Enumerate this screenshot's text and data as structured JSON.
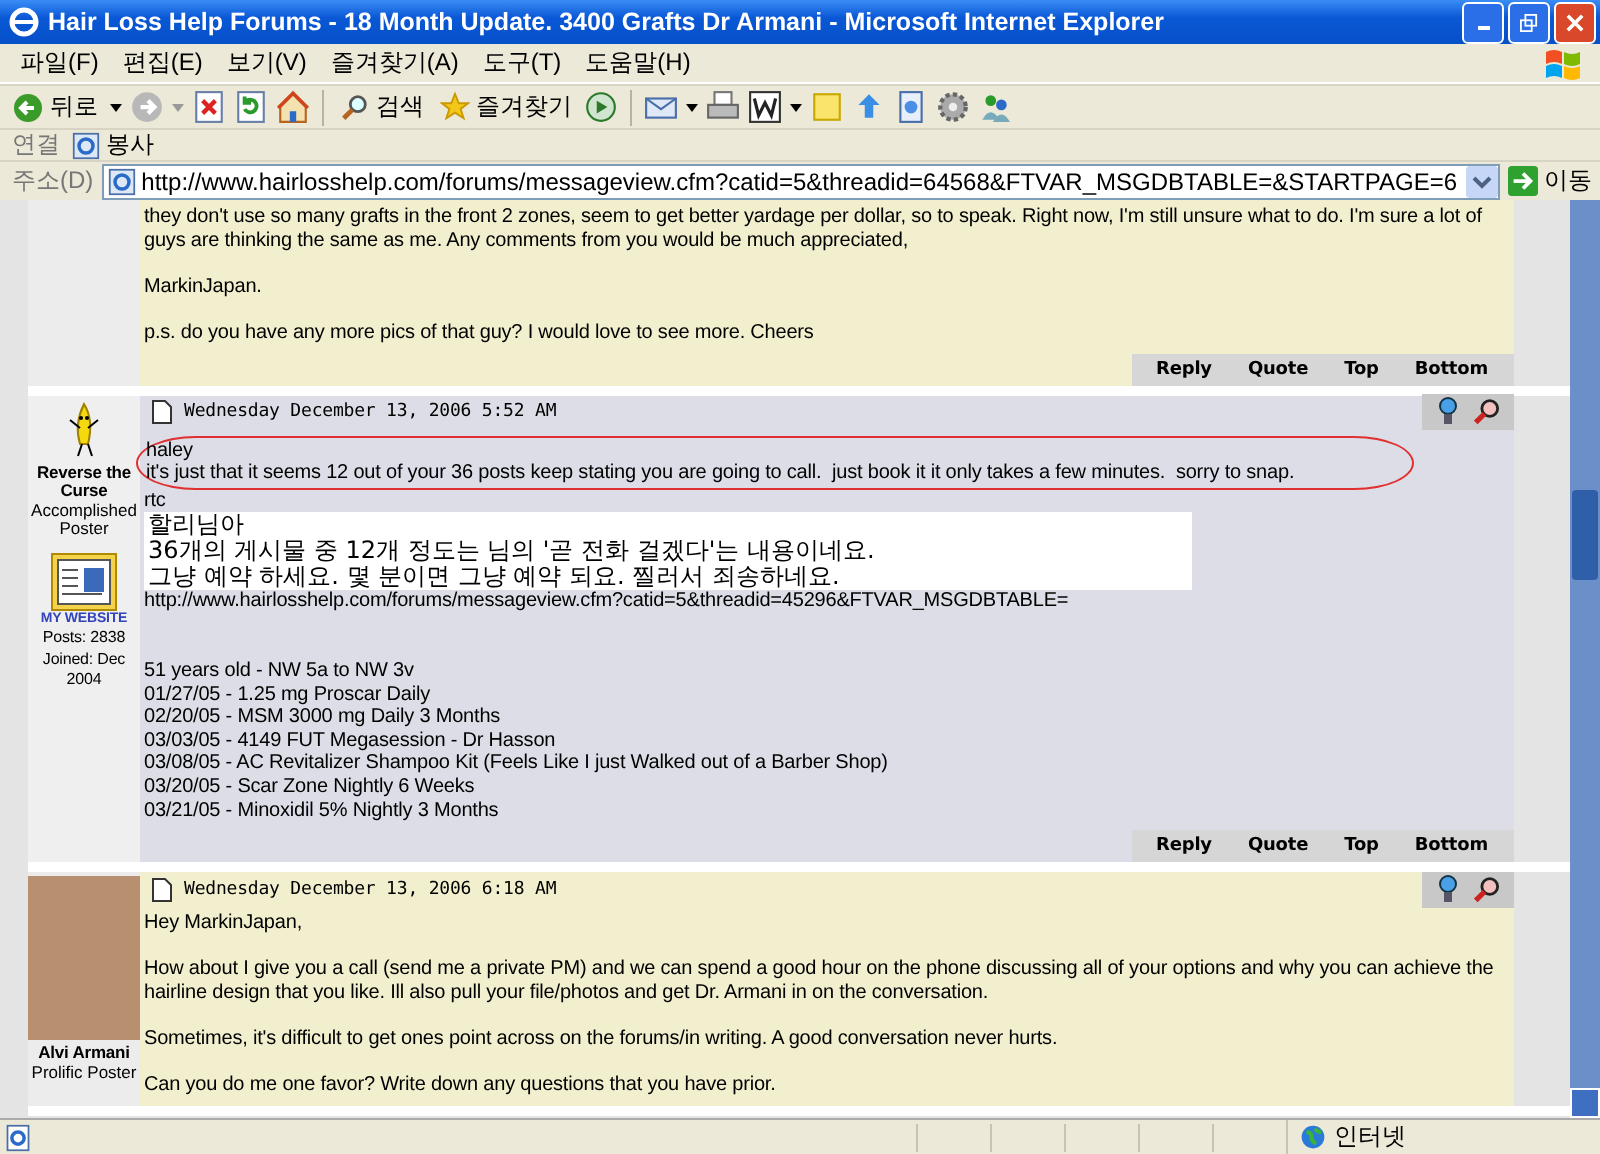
{
  "window": {
    "title": "Hair Loss Help Forums - 18 Month Update. 3400 Grafts Dr Armani - Microsoft Internet Explorer"
  },
  "menu": [
    "파일(F)",
    "편집(E)",
    "보기(V)",
    "즐겨찾기(A)",
    "도구(T)",
    "도움말(H)"
  ],
  "toolbar": {
    "back": "뒤로",
    "search": "검색",
    "favorites": "즐겨찾기"
  },
  "links_bar": {
    "label": "연결",
    "links": [
      "봉사"
    ]
  },
  "address_bar": {
    "label": "주소(D)",
    "url": "http://www.hairlosshelp.com/forums/messageview.cfm?catid=5&threadid=64568&FTVAR_MSGDBTABLE=&STARTPAGE=6",
    "go": "이동"
  },
  "posts": [
    {
      "kind": "beige",
      "body": [
        {
          "kind": "para",
          "lines": [
            "they don't use so many grafts in the front 2 zones, seem to get better yardage per dollar, so to speak. Right now, I'm still unsure what to do. I'm sure a lot of guys are thinking the same as me. Any comments from you would be much appreciated,"
          ]
        },
        {
          "kind": "para",
          "lines": [
            "MarkinJapan."
          ]
        },
        {
          "kind": "line",
          "lines": [
            "p.s. do you have any more pics of that guy? I would love to see more. Cheers"
          ]
        }
      ],
      "actions": [
        "Reply",
        "Quote",
        "Top",
        "Bottom"
      ]
    },
    {
      "kind": "grey",
      "avatar": {
        "kind": "banana"
      },
      "author": "Reverse the Curse",
      "rank": "Accomplished Poster",
      "website": "MY WEBSITE",
      "stats": [
        "Posts: 2838",
        "Joined: Dec 2004"
      ],
      "date": "Wednesday December 13, 2006 5:52 AM",
      "body": [
        {
          "kind": "circled",
          "lines": [
            "haley",
            "it's just that it seems 12 out of your 36 posts keep stating you are going to call.  just book it it only takes a few minutes.  sorry to snap."
          ]
        },
        {
          "kind": "line",
          "lines": [
            "rtc"
          ]
        },
        {
          "kind": "translation",
          "lines": [
            "할리님아",
            "36개의 게시물 중 12개 정도는 님의 '곧 전화 걸겠다'는 내용이네요.",
            "그냥 예약 하세요. 몇 분이면 그냥 예약 되요. 찔러서 죄송하네요."
          ]
        },
        {
          "kind": "section",
          "lines": [
            "http://www.hairlosshelp.com/forums/messageview.cfm?catid=5&threadid=45296&FTVAR_MSGDBTABLE="
          ]
        },
        {
          "kind": "line",
          "lines": [
            "51 years old - NW 5a to NW 3v",
            "01/27/05 - 1.25 mg Proscar Daily",
            "02/20/05 - MSM 3000 mg Daily 3 Months",
            "03/03/05 - 4149 FUT Megasession - Dr Hasson",
            "03/08/05 - AC Revitalizer Shampoo Kit (Feels Like I just Walked out of a Barber Shop)",
            "03/20/05 - Scar Zone Nightly 6 Weeks",
            "03/21/05 - Minoxidil 5% Nightly 3 Months"
          ]
        }
      ],
      "actions": [
        "Reply",
        "Quote",
        "Top",
        "Bottom"
      ]
    },
    {
      "kind": "beige",
      "avatar": {
        "kind": "photo"
      },
      "author": "Alvi Armani",
      "rank": "Prolific Poster",
      "date": "Wednesday December 13, 2006 6:18 AM",
      "body": [
        {
          "kind": "para",
          "lines": [
            "Hey MarkinJapan,"
          ]
        },
        {
          "kind": "para",
          "lines": [
            "How about I give you a call (send me a private PM) and we can spend a good hour on the phone discussing all of your options and why you can achieve the hairline design that you like. Ill also pull your file/photos and get Dr. Armani in on the conversation."
          ]
        },
        {
          "kind": "para",
          "lines": [
            "Sometimes, it's difficult to get ones point across on the forums/in writing. A good conversation never hurts."
          ]
        },
        {
          "kind": "line",
          "lines": [
            "Can you do me one favor? Write down any questions that you have prior."
          ]
        }
      ]
    }
  ],
  "status_bar": {
    "zone": "인터넷"
  }
}
